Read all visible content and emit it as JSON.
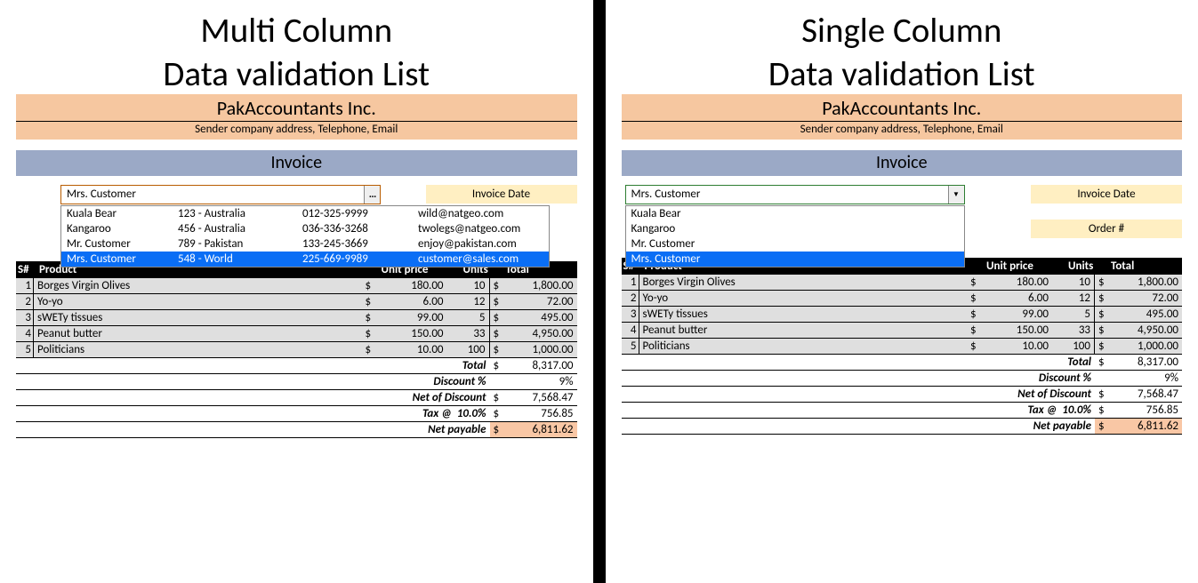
{
  "left": {
    "title1": "Multi Column",
    "title2": "Data validation List",
    "company": "PakAccountants Inc.",
    "sub": "Sender company address, Telephone, Email",
    "invoice_label": "Invoice",
    "invoice_date_label": "Invoice Date",
    "combo_value": "Mrs. Customer",
    "dropdown": [
      {
        "name": "Kuala Bear",
        "addr": "123 - Australia",
        "phone": "012-325-9999",
        "email": "wild@natgeo.com",
        "sel": false
      },
      {
        "name": "Kangaroo",
        "addr": "456 - Australia",
        "phone": "036-336-3268",
        "email": "twolegs@natgeo.com",
        "sel": false
      },
      {
        "name": "Mr. Customer",
        "addr": "789 - Pakistan",
        "phone": "133-245-3669",
        "email": "enjoy@pakistan.com",
        "sel": false
      },
      {
        "name": "Mrs. Customer",
        "addr": "548 - World",
        "phone": "225-669-9989",
        "email": "customer@sales.com",
        "sel": true
      }
    ],
    "headers": {
      "sn": "S#",
      "product": "Product",
      "unit_price": "Unit price",
      "units": "Units",
      "total": "Total"
    },
    "rows": [
      {
        "sn": "1",
        "product": "Borges Virgin Olives",
        "cur": "$",
        "up": "180.00",
        "units": "10",
        "cur2": "$",
        "total": "1,800.00"
      },
      {
        "sn": "2",
        "product": "Yo-yo",
        "cur": "$",
        "up": "6.00",
        "units": "12",
        "cur2": "$",
        "total": "72.00"
      },
      {
        "sn": "3",
        "product": "sWETy tissues",
        "cur": "$",
        "up": "99.00",
        "units": "5",
        "cur2": "$",
        "total": "495.00"
      },
      {
        "sn": "4",
        "product": "Peanut butter",
        "cur": "$",
        "up": "150.00",
        "units": "33",
        "cur2": "$",
        "total": "4,950.00"
      },
      {
        "sn": "5",
        "product": "Politicians",
        "cur": "$",
        "up": "10.00",
        "units": "100",
        "cur2": "$",
        "total": "1,000.00"
      }
    ],
    "summary": {
      "total_label": "Total",
      "total_cur": "$",
      "total_val": "8,317.00",
      "disc_label": "Discount %",
      "disc_val": "9%",
      "net_of_disc_label": "Net of Discount",
      "net_of_disc_cur": "$",
      "net_of_disc_val": "7,568.47",
      "tax_label": "Tax @",
      "tax_rate": "10.0%",
      "tax_cur": "$",
      "tax_val": "756.85",
      "net_pay_label": "Net payable",
      "net_pay_cur": "$",
      "net_pay_val": "6,811.62"
    }
  },
  "right": {
    "title1": "Single Column",
    "title2": "Data validation List",
    "company": "PakAccountants Inc.",
    "sub": "Sender company address, Telephone, Email",
    "invoice_label": "Invoice",
    "invoice_date_label": "Invoice Date",
    "order_label": "Order #",
    "combo_value": "Mrs. Customer",
    "dropdown": [
      {
        "name": "Kuala Bear",
        "sel": false
      },
      {
        "name": "Kangaroo",
        "sel": false
      },
      {
        "name": "Mr. Customer",
        "sel": false
      },
      {
        "name": "Mrs. Customer",
        "sel": true
      }
    ],
    "headers": {
      "sn": "S#",
      "product": "Product",
      "unit_price": "Unit price",
      "units": "Units",
      "total": "Total"
    },
    "rows": [
      {
        "sn": "1",
        "product": "Borges Virgin Olives",
        "cur": "$",
        "up": "180.00",
        "units": "10",
        "cur2": "$",
        "total": "1,800.00"
      },
      {
        "sn": "2",
        "product": "Yo-yo",
        "cur": "$",
        "up": "6.00",
        "units": "12",
        "cur2": "$",
        "total": "72.00"
      },
      {
        "sn": "3",
        "product": "sWETy tissues",
        "cur": "$",
        "up": "99.00",
        "units": "5",
        "cur2": "$",
        "total": "495.00"
      },
      {
        "sn": "4",
        "product": "Peanut butter",
        "cur": "$",
        "up": "150.00",
        "units": "33",
        "cur2": "$",
        "total": "4,950.00"
      },
      {
        "sn": "5",
        "product": "Politicians",
        "cur": "$",
        "up": "10.00",
        "units": "100",
        "cur2": "$",
        "total": "1,000.00"
      }
    ],
    "summary": {
      "total_label": "Total",
      "total_cur": "$",
      "total_val": "8,317.00",
      "disc_label": "Discount %",
      "disc_val": "9%",
      "net_of_disc_label": "Net of Discount",
      "net_of_disc_cur": "$",
      "net_of_disc_val": "7,568.47",
      "tax_label": "Tax @",
      "tax_rate": "10.0%",
      "tax_cur": "$",
      "tax_val": "756.85",
      "net_pay_label": "Net payable",
      "net_pay_cur": "$",
      "net_pay_val": "6,811.62"
    }
  }
}
